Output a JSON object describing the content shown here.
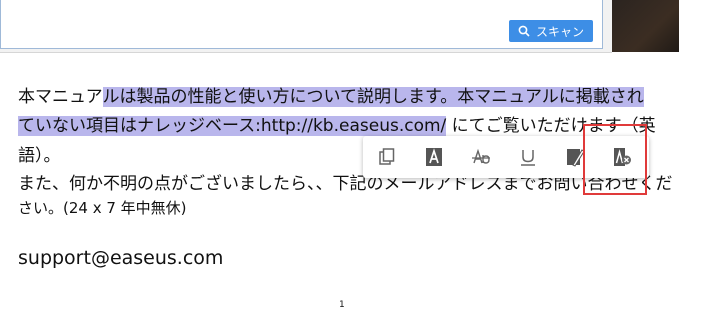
{
  "top_window": {
    "scan_button_label": "スキャン",
    "scan_button_color": "#3d8ee6"
  },
  "document": {
    "line1_plain": "本マニュア",
    "line1_highlight": "ルは製品の性能と使い方について説明します。本マニュアルに掲載され",
    "line2_highlight": "ていない項目はナレッジベース:http://kb.easeus.com/",
    "line2_plain": " にてご覧いただけます（英",
    "line3": "語）。",
    "line4": "また、何か不明の点がございましたら、、下記のメールアドレスまでお問い合わせくだ",
    "line5": "さい。(24 x 7 年中無休)",
    "email": "support@easeus.com",
    "page_number": "1",
    "highlight_color": "#b9b6ec"
  },
  "toolbar": {
    "items": [
      {
        "icon": "copy-icon"
      },
      {
        "icon": "highlight-text-icon"
      },
      {
        "icon": "strikethrough-icon"
      },
      {
        "icon": "underline-icon"
      },
      {
        "icon": "highlighter-pen-icon"
      },
      {
        "icon": "remove-highlight-icon"
      }
    ],
    "selected_outline_color": "#e03a3a"
  }
}
